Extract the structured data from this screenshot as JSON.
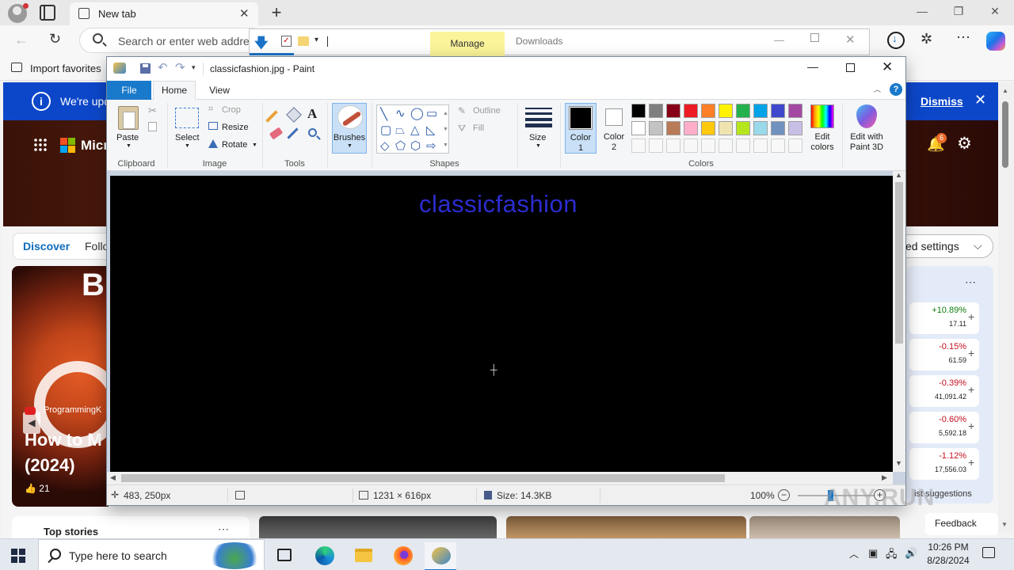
{
  "browser": {
    "tab_title": "New tab",
    "address_placeholder": "Search or enter web address",
    "favorites_import": "Import favorites"
  },
  "explorer": {
    "manage_tab": "Manage",
    "title": "Downloads"
  },
  "msn": {
    "banner_text": "We're upd",
    "banner_dismiss": "Dismiss",
    "brand": "Micr",
    "notification_count": "6",
    "discover_tab": "Discover",
    "following_tab": "Follo",
    "settings_pill": "ed settings",
    "hero_source": "ProgrammingK",
    "hero_title_line1": "How to M",
    "hero_title_line2": "(2024)",
    "hero_likes": "21",
    "top_stories": "Top stories",
    "list_suggestions": "ist suggestions",
    "feedback": "Feedback",
    "markets": [
      {
        "change": "+10.89%",
        "value": "17.11",
        "color": "#107c10"
      },
      {
        "change": "-0.15%",
        "value": "61.59",
        "color": "#c50f1f"
      },
      {
        "change": "-0.39%",
        "value": "41,091.42",
        "color": "#c50f1f"
      },
      {
        "change": "-0.60%",
        "value": "5,592.18",
        "color": "#c50f1f"
      },
      {
        "change": "-1.12%",
        "value": "17,556.03",
        "color": "#c50f1f"
      }
    ]
  },
  "paint": {
    "window_title": "classicfashion.jpg - Paint",
    "tabs": {
      "file": "File",
      "home": "Home",
      "view": "View"
    },
    "ribbon": {
      "paste": "Paste",
      "select": "Select",
      "crop": "Crop",
      "resize": "Resize",
      "rotate": "Rotate",
      "brushes": "Brushes",
      "outline": "Outline",
      "fill": "Fill",
      "size": "Size",
      "color1": "Color\n1",
      "color2": "Color\n2",
      "edit_colors": "Edit\ncolors",
      "edit_paint3d": "Edit with\nPaint 3D"
    },
    "groups": {
      "clipboard": "Clipboard",
      "image": "Image",
      "tools": "Tools",
      "shapes": "Shapes",
      "colors": "Colors"
    },
    "palette_row1": [
      "#000000",
      "#7f7f7f",
      "#880015",
      "#ed1c24",
      "#ff7f27",
      "#fff200",
      "#22b14c",
      "#00a2e8",
      "#3f48cc",
      "#a349a4"
    ],
    "palette_row2": [
      "#ffffff",
      "#c3c3c3",
      "#b97a57",
      "#ffaec9",
      "#ffc90e",
      "#efe4b0",
      "#b5e61d",
      "#99d9ea",
      "#7092be",
      "#c8bfe7"
    ],
    "canvas_text": "classicfashion",
    "canvas_text_color": "#2c2ccf",
    "status": {
      "cursor_pos": "483, 250px",
      "dimensions": "1231 × 616px",
      "file_size": "Size: 14.3KB",
      "zoom": "100%"
    }
  },
  "taskbar": {
    "search_placeholder": "Type here to search",
    "time": "10:26 PM",
    "date": "8/28/2024"
  },
  "watermark": "ANY.RUN"
}
